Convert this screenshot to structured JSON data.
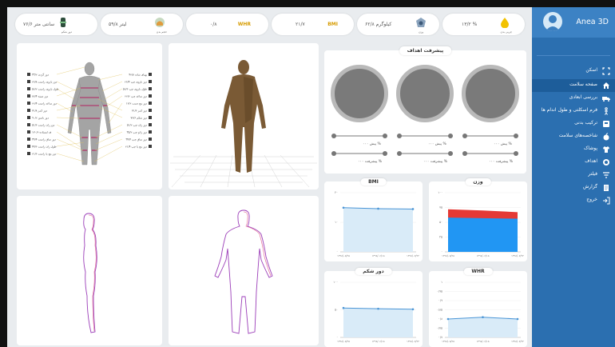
{
  "stats": [
    {
      "value": "۷۶/۶ سانتی متر",
      "sub": "دور شکم",
      "icon": "waist-icon"
    },
    {
      "value": "۵۹/۸ لیتر",
      "sub": "حجم بدن",
      "icon": "body-volume-icon"
    },
    {
      "value": "۰/۸",
      "label": "WHR"
    },
    {
      "value": "۲۱/۷",
      "label": "BMI"
    },
    {
      "value": "۶۲/۸ کیلوگرم",
      "sub": "وزن",
      "icon": "weight-icon"
    },
    {
      "value": "۱۳/۲ %",
      "sub": "چربی بدن",
      "icon": "body-fat-icon"
    }
  ],
  "sidebar": {
    "brand": "Anea 3D",
    "items": [
      {
        "label": "اسکن",
        "icon": "scan-icon",
        "active": false
      },
      {
        "label": "صفحه سلامت",
        "icon": "home-icon",
        "active": true
      },
      {
        "label": "بررسی ابعادی",
        "icon": "truck-icon",
        "active": false
      },
      {
        "label": "فرم اسکلتی و طول اندام ها",
        "icon": "body-form-icon",
        "active": false
      },
      {
        "label": "ترکیب بدنی",
        "icon": "body-composition-icon",
        "active": false
      },
      {
        "label": "شاخصه‌های سلامت",
        "icon": "apple-icon",
        "active": false
      },
      {
        "label": "پوشاک",
        "icon": "clothing-icon",
        "active": false
      },
      {
        "label": "اهداف",
        "icon": "target-icon",
        "active": false
      },
      {
        "label": "فیلتر",
        "icon": "filter-icon",
        "active": false
      },
      {
        "label": "گزارش",
        "icon": "report-icon",
        "active": false
      },
      {
        "label": "خروج",
        "icon": "logout-icon",
        "active": false
      }
    ]
  },
  "goals": {
    "title": "پیشرفت اهداف",
    "items": [
      {
        "label1": "پیش ۰۰۰ %",
        "label2": "پیشرفت ۰۰۰ %"
      },
      {
        "label1": "پیش ۰۰۰ %",
        "label2": "پیشرفت ۰۰۰ %"
      },
      {
        "label1": "پیش ۰۰۰ %",
        "label2": "پیشرفت ۰۰۰ %"
      }
    ]
  },
  "measurements": {
    "left": [
      "دور گردن ۳۳/۲",
      "دور بازوی راست ۲۶/۸",
      "طول بازوی راست ۵۲/۲",
      "دور سینه ۸۶/۴",
      "دور ساعد راست ۲۲/۴",
      "دور کمر ۷۱/۸",
      "دور باسن ۹۰/۲",
      "دور ران راست ۵۱/۶",
      "قد ایستاده ۱۷۰/۲",
      "دور ساق راست ۳۴/۴",
      "طول ران راست ۴۴/۶",
      "دور مچ پا راست ۲۱/۶"
    ],
    "right": [
      "پهنای شانه ۴۲/۸",
      "دور بازوی چپ ۲۶/۴",
      "طول بازوی چپ ۵۲/۶",
      "دور ساعد چپ ۲۲/۲",
      "دور مچ دست ۱۶/۲",
      "دور کمر ۷۱/۶",
      "دور شکم ۷۶/۶",
      "دور ران چپ ۵۱/۲",
      "دور زانو چپ ۳۵/۲",
      "دور ساق چپ ۳۴/۴",
      "دور مچ پا چپ ۲۱/۴"
    ]
  },
  "chart_data": [
    {
      "type": "line",
      "title": "BMI",
      "x": [
        "۱۳۹۸/۰۵/۲۵",
        "۱۳۹۸/۰۶/۱۵",
        "۱۳۹۸/۰۷/۲۲"
      ],
      "series": [
        {
          "values": [
            22.4,
            21.9,
            21.7
          ]
        }
      ],
      "yticks": [
        "۰",
        "۱۰",
        "۲۰"
      ],
      "ylim": [
        0,
        30
      ]
    },
    {
      "type": "area",
      "title": "وزن",
      "x": [
        "۱۳۹۸/۰۵/۲۵",
        "۱۳۹۸/۰۶/۱۵",
        "۱۳۹۸/۰۷/۲۲"
      ],
      "series": [
        {
          "values": [
            58,
            57,
            56
          ],
          "color": "#2196f3"
        },
        {
          "values": [
            72,
            70,
            67
          ],
          "color": "#e53935"
        }
      ],
      "yticks": [
        "۰",
        "۲۵",
        "۵۰",
        "۷۵",
        "۱۰۰"
      ],
      "ylim": [
        0,
        100
      ]
    },
    {
      "type": "line",
      "title": "دور شکم",
      "x": [
        "۱۳۹۸/۰۵/۲۵",
        "۱۳۹۸/۰۶/۱۵",
        "۱۳۹۸/۰۷/۲۲"
      ],
      "series": [
        {
          "values": [
            80,
            78,
            76.6
          ]
        }
      ],
      "yticks": [
        "۰",
        "۵۰",
        "۱۰۰"
      ],
      "ylim": [
        0,
        150
      ]
    },
    {
      "type": "line",
      "title": "WHR",
      "x": [
        "۱۳۹۸/۰۵/۲۵",
        "۱۳۹۸/۰۶/۱۵",
        "۱۳۹۸/۰۷/۲۲"
      ],
      "series": [
        {
          "values": [
            0.8,
            0.81,
            0.8
          ]
        }
      ],
      "yticks": [
        "۰/۷",
        "۰/۷۵",
        "۰/۸",
        "۰/۸۵",
        "۰/۹",
        "۰/۹۵",
        "۱"
      ],
      "ylim": [
        0.7,
        1.0
      ]
    }
  ]
}
